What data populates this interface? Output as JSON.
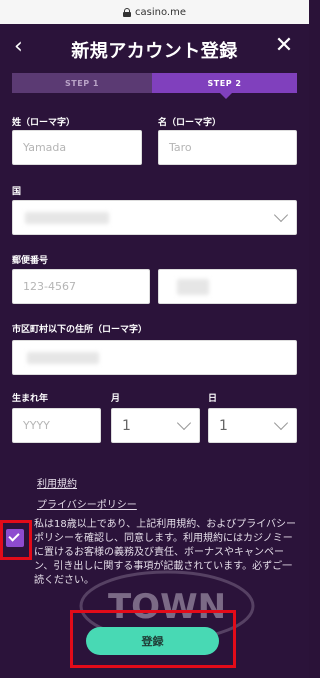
{
  "browser": {
    "url": "casino.me"
  },
  "header": {
    "back_glyph": "‹",
    "title": "新規アカウント登録",
    "close_glyph": "✕"
  },
  "steps": {
    "step1": "STEP 1",
    "step2": "STEP 2"
  },
  "form": {
    "last_name": {
      "label": "姓（ローマ字）",
      "placeholder": "Yamada"
    },
    "first_name": {
      "label": "名（ローマ字）",
      "placeholder": "Taro"
    },
    "country": {
      "label": "国"
    },
    "postal": {
      "label": "郵便番号",
      "placeholder": "123-4567"
    },
    "address": {
      "label": "市区町村以下の住所（ローマ字）"
    },
    "birth_year": {
      "label": "生まれ年",
      "placeholder": "YYYY"
    },
    "month": {
      "label": "月",
      "value": "1"
    },
    "day": {
      "label": "日",
      "value": "1"
    }
  },
  "links": {
    "terms": "利用規約",
    "privacy": "プライバシーポリシー"
  },
  "agree_text": "私は18歳以上であり、上記利用規約、およびプライバシーポリシーを確認し、同意します。利用規約にはカジノミーに置けるお客様の義務及び責任、ボーナスやキャンペーン、引き出しに関する事項が記載されています。必ずご一読ください。",
  "submit_label": "登録",
  "watermark": "TOWN",
  "colors": {
    "background": "#2b133a",
    "step_active": "#8040bd",
    "button": "#48d9b4",
    "highlight": "#e30b19",
    "checkbox": "#8d4bcf"
  }
}
